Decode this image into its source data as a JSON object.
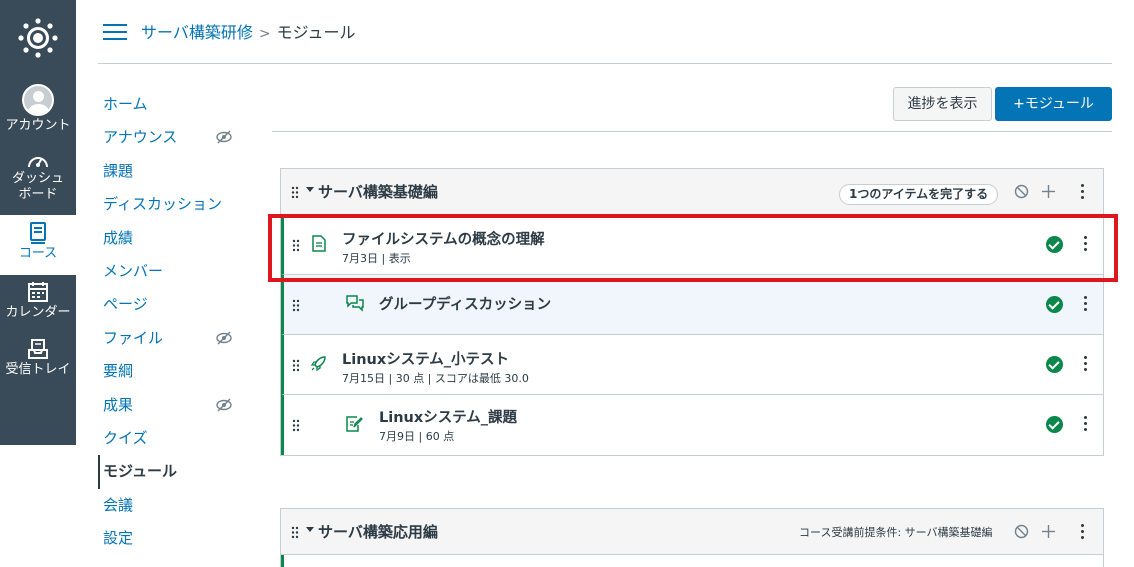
{
  "global_nav": {
    "account": "アカウント",
    "dashboard_line1": "ダッシュ",
    "dashboard_line2": "ボード",
    "courses": "コース",
    "calendar": "カレンダー",
    "inbox": "受信トレイ"
  },
  "breadcrumb": {
    "course": "サーバ構築研修",
    "separator": ">",
    "current": "モジュール"
  },
  "course_nav": [
    {
      "label": "ホーム",
      "hidden": false
    },
    {
      "label": "アナウンス",
      "hidden": true
    },
    {
      "label": "課題",
      "hidden": false
    },
    {
      "label": "ディスカッション",
      "hidden": false
    },
    {
      "label": "成績",
      "hidden": false
    },
    {
      "label": "メンバー",
      "hidden": false
    },
    {
      "label": "ページ",
      "hidden": false
    },
    {
      "label": "ファイル",
      "hidden": true
    },
    {
      "label": "要綱",
      "hidden": false
    },
    {
      "label": "成果",
      "hidden": true
    },
    {
      "label": "クイズ",
      "hidden": false
    },
    {
      "label": "モジュール",
      "hidden": false,
      "active": true
    },
    {
      "label": "会議",
      "hidden": false
    },
    {
      "label": "設定",
      "hidden": false
    }
  ],
  "toolbar": {
    "progress_label": "進捗を表示",
    "add_module_label": "+モジュール"
  },
  "modules": [
    {
      "title": "サーバ構築基礎編",
      "requirement": "1つのアイテムを完了する",
      "items": [
        {
          "title": "ファイルシステムの概念の理解",
          "meta": "7月3日 | 表示",
          "icon": "page-icon",
          "completed": true
        },
        {
          "title": "グループディスカッション",
          "meta": "",
          "icon": "discussion-icon",
          "completed": true
        },
        {
          "title": "Linuxシステム_小テスト",
          "meta": "7月15日 | 30 点 | スコアは最低 30.0",
          "icon": "quiz-rocket-icon",
          "completed": true
        },
        {
          "title": "Linuxシステム_課題",
          "meta": "7月9日 | 60 点",
          "icon": "assignment-icon",
          "completed": true
        }
      ]
    },
    {
      "title": "サーバ構築応用編",
      "prerequisite": "コース受講前提条件: サーバ構築基礎編"
    }
  ],
  "colors": {
    "nav_bg": "#394b58",
    "link": "#0374b5",
    "success": "#0b874b",
    "highlight": "#e0161e"
  }
}
